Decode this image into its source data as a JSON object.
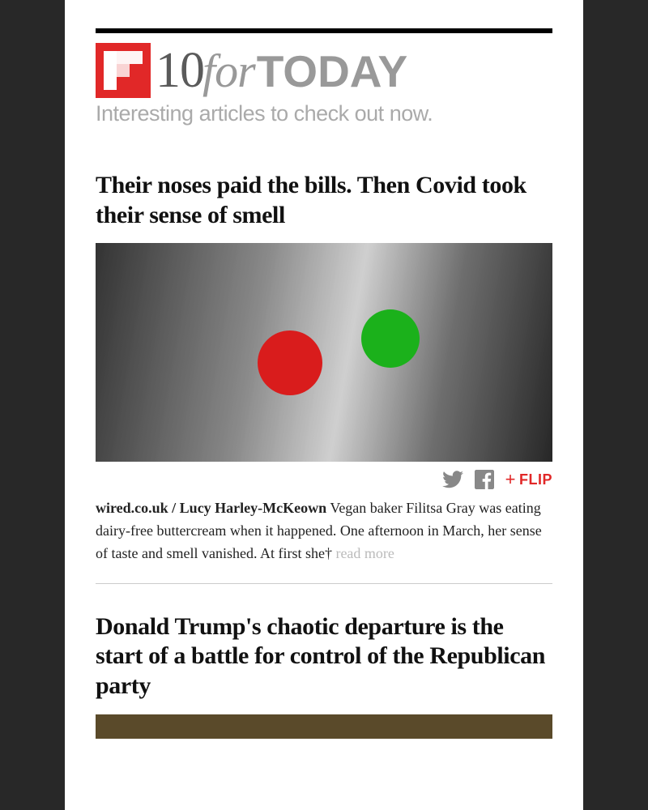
{
  "brand": {
    "ten": "10",
    "for": "for",
    "today": "TODAY",
    "tagline": "Interesting articles to check out now."
  },
  "actions": {
    "flip_label": "FLIP"
  },
  "articles": [
    {
      "headline": "Their noses paid the bills. Then Covid took their sense of smell",
      "source": "wired.co.uk / Lucy Harley-McKeown",
      "excerpt": " Vegan baker Filitsa Gray was eating dairy-free buttercream when it happened. One afternoon in March, her sense of taste and smell vanished. At first she† ",
      "readmore": "read more"
    },
    {
      "headline": "Donald Trump's chaotic departure is the start of a battle for control of the Republican party"
    }
  ]
}
